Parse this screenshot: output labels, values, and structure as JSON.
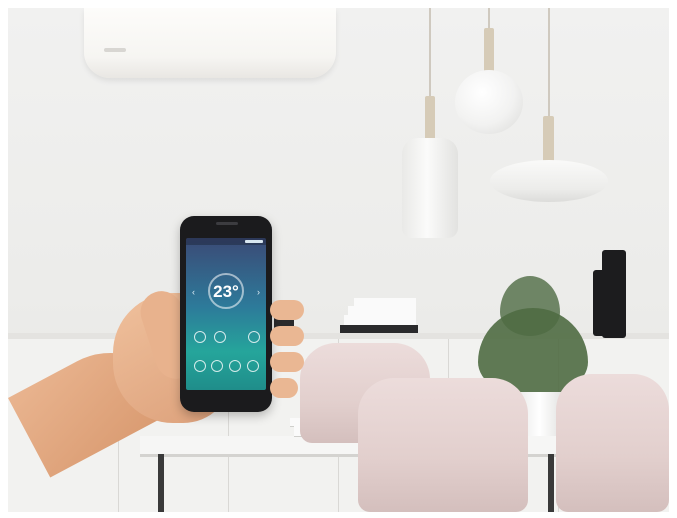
{
  "scene": "smart-home-ac-control",
  "phone": {
    "temperature": "23°",
    "left_arrow": "‹",
    "right_arrow": "›"
  },
  "colors": {
    "screen_top": "#3b4a76",
    "screen_bottom": "#1f8d8a",
    "chair": "#e2cfcd",
    "plant": "#4f6b43"
  }
}
